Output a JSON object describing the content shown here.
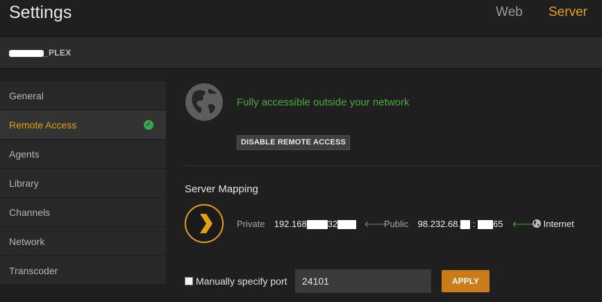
{
  "header": {
    "title": "Settings",
    "tabs": [
      {
        "label": "Web",
        "active": false
      },
      {
        "label": "Server",
        "active": true
      }
    ]
  },
  "server": {
    "name_suffix": "_PLEX"
  },
  "sidebar": {
    "items": [
      {
        "label": "General"
      },
      {
        "label": "Remote Access",
        "active": true,
        "badge": "check-icon"
      },
      {
        "label": "Agents"
      },
      {
        "label": "Library"
      },
      {
        "label": "Channels"
      },
      {
        "label": "Network"
      },
      {
        "label": "Transcoder"
      }
    ]
  },
  "remote_access": {
    "status": "Fully accessible outside your network",
    "disable_button": "DISABLE REMOTE ACCESS",
    "section_title": "Server Mapping",
    "private_label": "Private",
    "private_prefix": "192.168",
    "private_mid": "32",
    "public_label": "Public",
    "public_prefix": "98.232.68.",
    "public_sep": ":",
    "public_suffix": "65",
    "internet_label": "Internet"
  },
  "port": {
    "checkbox_label": "Manually specify port",
    "checked": false,
    "value": "24101",
    "apply_button": "APPLY"
  },
  "colors": {
    "accent": "#e5a00d",
    "success": "#4caa3e",
    "apply": "#cc7b19"
  }
}
